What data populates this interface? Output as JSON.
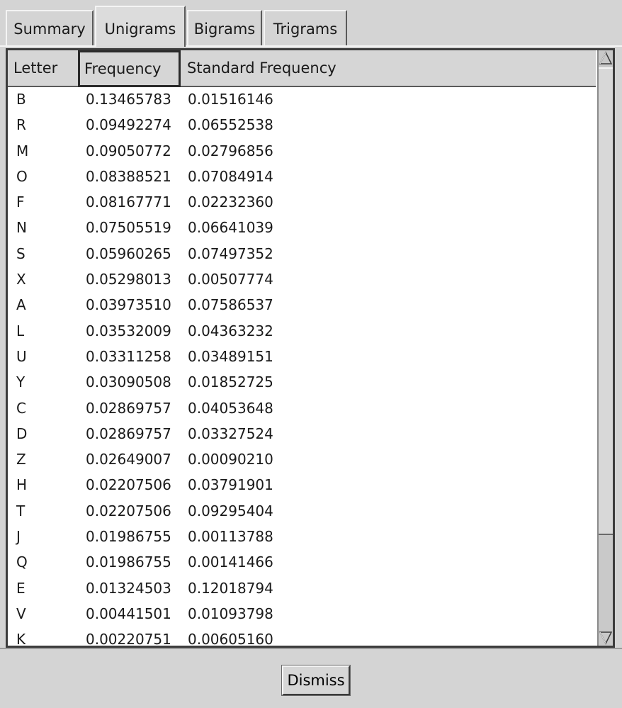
{
  "tabs": [
    {
      "label": "Summary",
      "active": false
    },
    {
      "label": "Unigrams",
      "active": true
    },
    {
      "label": "Bigrams",
      "active": false
    },
    {
      "label": "Trigrams",
      "active": false
    }
  ],
  "table": {
    "columns": [
      "Letter",
      "Frequency",
      "Standard Frequency"
    ],
    "sorted_column": "Frequency",
    "rows": [
      [
        "B",
        "0.13465783",
        "0.01516146"
      ],
      [
        "R",
        "0.09492274",
        "0.06552538"
      ],
      [
        "M",
        "0.09050772",
        "0.02796856"
      ],
      [
        "O",
        "0.08388521",
        "0.07084914"
      ],
      [
        "F",
        "0.08167771",
        "0.02232360"
      ],
      [
        "N",
        "0.07505519",
        "0.06641039"
      ],
      [
        "S",
        "0.05960265",
        "0.07497352"
      ],
      [
        "X",
        "0.05298013",
        "0.00507774"
      ],
      [
        "A",
        "0.03973510",
        "0.07586537"
      ],
      [
        "L",
        "0.03532009",
        "0.04363232"
      ],
      [
        "U",
        "0.03311258",
        "0.03489151"
      ],
      [
        "Y",
        "0.03090508",
        "0.01852725"
      ],
      [
        "C",
        "0.02869757",
        "0.04053648"
      ],
      [
        "D",
        "0.02869757",
        "0.03327524"
      ],
      [
        "Z",
        "0.02649007",
        "0.00090210"
      ],
      [
        "H",
        "0.02207506",
        "0.03791901"
      ],
      [
        "T",
        "0.02207506",
        "0.09295404"
      ],
      [
        "J",
        "0.01986755",
        "0.00113788"
      ],
      [
        "Q",
        "0.01986755",
        "0.00141466"
      ],
      [
        "E",
        "0.01324503",
        "0.12018794"
      ],
      [
        "V",
        "0.00441501",
        "0.01093798"
      ],
      [
        "K",
        "0.00220751",
        "0.00605160"
      ]
    ]
  },
  "scrollbar": {
    "up_icon": "arrow-up-icon",
    "down_icon": "arrow-down-icon",
    "visible_fraction": 0.79
  },
  "buttons": {
    "dismiss_label": "Dismiss"
  }
}
